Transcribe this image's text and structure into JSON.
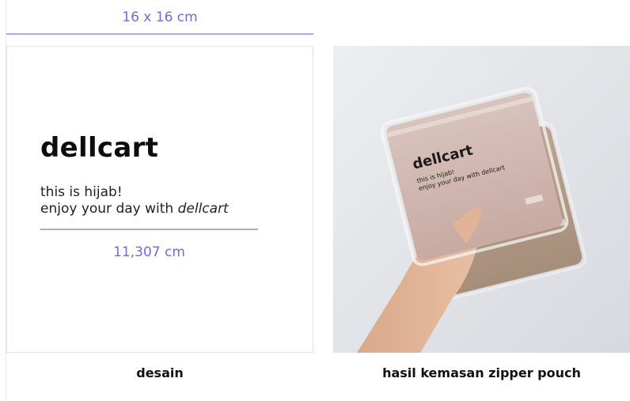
{
  "top_dimension": "16 x 16 cm",
  "design": {
    "brand": "dellcart",
    "tagline_line1": "this is hijab!",
    "tagline_line2_prefix": "enjoy your day with ",
    "tagline_line2_brand": "dellcart",
    "dimension": "11,307 cm"
  },
  "photo": {
    "pouch_brand": "dellcart",
    "pouch_line1": "this is hijab!",
    "pouch_line2": "enjoy your day with dellcart"
  },
  "captions": {
    "left": "desain",
    "right": "hasil kemasan zipper pouch"
  },
  "colors": {
    "accent": "#6b6ee0",
    "line": "#a9abe8"
  }
}
